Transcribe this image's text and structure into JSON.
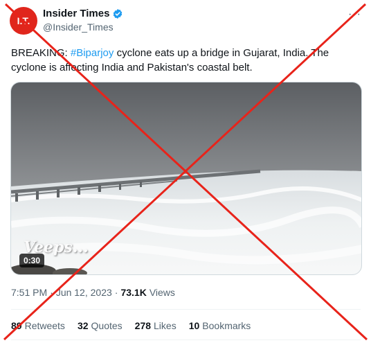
{
  "account": {
    "avatar_text": "I.T.",
    "display_name": "Insider Times",
    "handle": "@Insider_Times",
    "verified": true
  },
  "icons": {
    "more": "more-options-icon",
    "verified": "verified-badge-icon"
  },
  "tweet": {
    "text_prefix": "BREAKING: ",
    "hashtag": "#Biparjoy",
    "text_suffix": " cyclone eats up a bridge in Gujarat, India. The cyclone is affecting India and Pakistan's coastal belt."
  },
  "media": {
    "video_time": "0:30",
    "watermark": "Veeps..."
  },
  "meta": {
    "time": "7:51 PM",
    "separator": "·",
    "date": "Jun 12, 2023",
    "views_count": "73.1K",
    "views_label": "Views"
  },
  "stats": {
    "retweets_count": "89",
    "retweets_label": "Retweets",
    "quotes_count": "32",
    "quotes_label": "Quotes",
    "likes_count": "278",
    "likes_label": "Likes",
    "bookmarks_count": "10",
    "bookmarks_label": "Bookmarks"
  },
  "colors": {
    "brand_red": "#e0261c",
    "link_blue": "#1d9bf0",
    "cross_red": "#e8231a"
  }
}
